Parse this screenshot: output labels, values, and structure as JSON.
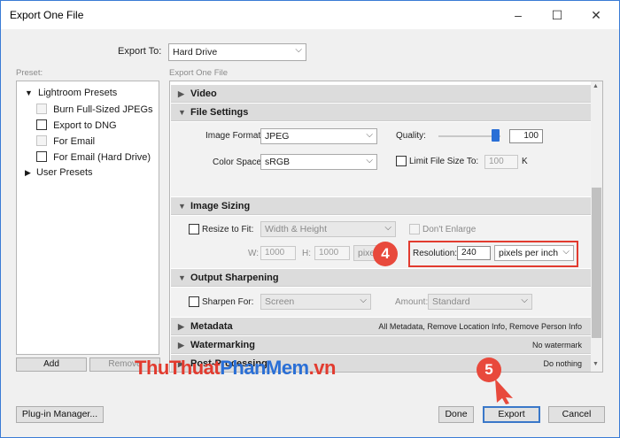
{
  "window": {
    "title": "Export One File",
    "minimize": "–",
    "maximize": "☐",
    "close": "✕"
  },
  "export_to": {
    "label": "Export To:",
    "value": "Hard Drive"
  },
  "preset": {
    "heading": "Preset:",
    "groups": [
      {
        "label": "Lightroom Presets",
        "expanded": true
      },
      {
        "label": "User Presets",
        "expanded": false
      }
    ],
    "items": [
      {
        "label": "Burn Full-Sized JPEGs",
        "enabled": false
      },
      {
        "label": "Export to DNG",
        "enabled": true
      },
      {
        "label": "For Email",
        "enabled": false
      },
      {
        "label": "For Email (Hard Drive)",
        "enabled": true
      }
    ],
    "add_label": "Add",
    "remove_label": "Remove"
  },
  "settings_heading": "Export One File",
  "sections": {
    "video": {
      "title": "Video"
    },
    "file_settings": {
      "title": "File Settings",
      "image_format_label": "Image Format:",
      "image_format_value": "JPEG",
      "quality_label": "Quality:",
      "quality_value": "100",
      "quality_fraction": 1.0,
      "color_space_label": "Color Space:",
      "color_space_value": "sRGB",
      "limit_size_label": "Limit File Size To:",
      "limit_size_value": "100",
      "limit_size_unit": "K"
    },
    "image_sizing": {
      "title": "Image Sizing",
      "resize_label": "Resize to Fit:",
      "resize_value": "Width & Height",
      "dont_enlarge_label": "Don't Enlarge",
      "w_label": "W:",
      "w_value": "1000",
      "h_label": "H:",
      "h_value": "1000",
      "unit_value": "pixels",
      "resolution_label": "Resolution:",
      "resolution_value": "240",
      "resolution_unit": "pixels per inch"
    },
    "output_sharpening": {
      "title": "Output Sharpening",
      "sharpen_label": "Sharpen For:",
      "sharpen_value": "Screen",
      "amount_label": "Amount:",
      "amount_value": "Standard"
    },
    "metadata": {
      "title": "Metadata",
      "summary": "All Metadata, Remove Location Info, Remove Person Info"
    },
    "watermarking": {
      "title": "Watermarking",
      "summary": "No watermark"
    },
    "post_processing": {
      "title": "Post-Processing",
      "summary": "Do nothing"
    }
  },
  "footer": {
    "plugin_manager": "Plug-in Manager...",
    "done": "Done",
    "export": "Export",
    "cancel": "Cancel"
  },
  "callouts": {
    "step4": "4",
    "step5": "5"
  },
  "watermark": {
    "part1": "ThuThuat",
    "part2": "PhanMem",
    "part3": ".vn"
  },
  "colors": {
    "callout": "#e8493c",
    "highlight": "#e23b2f",
    "accent": "#2a6fd6"
  }
}
